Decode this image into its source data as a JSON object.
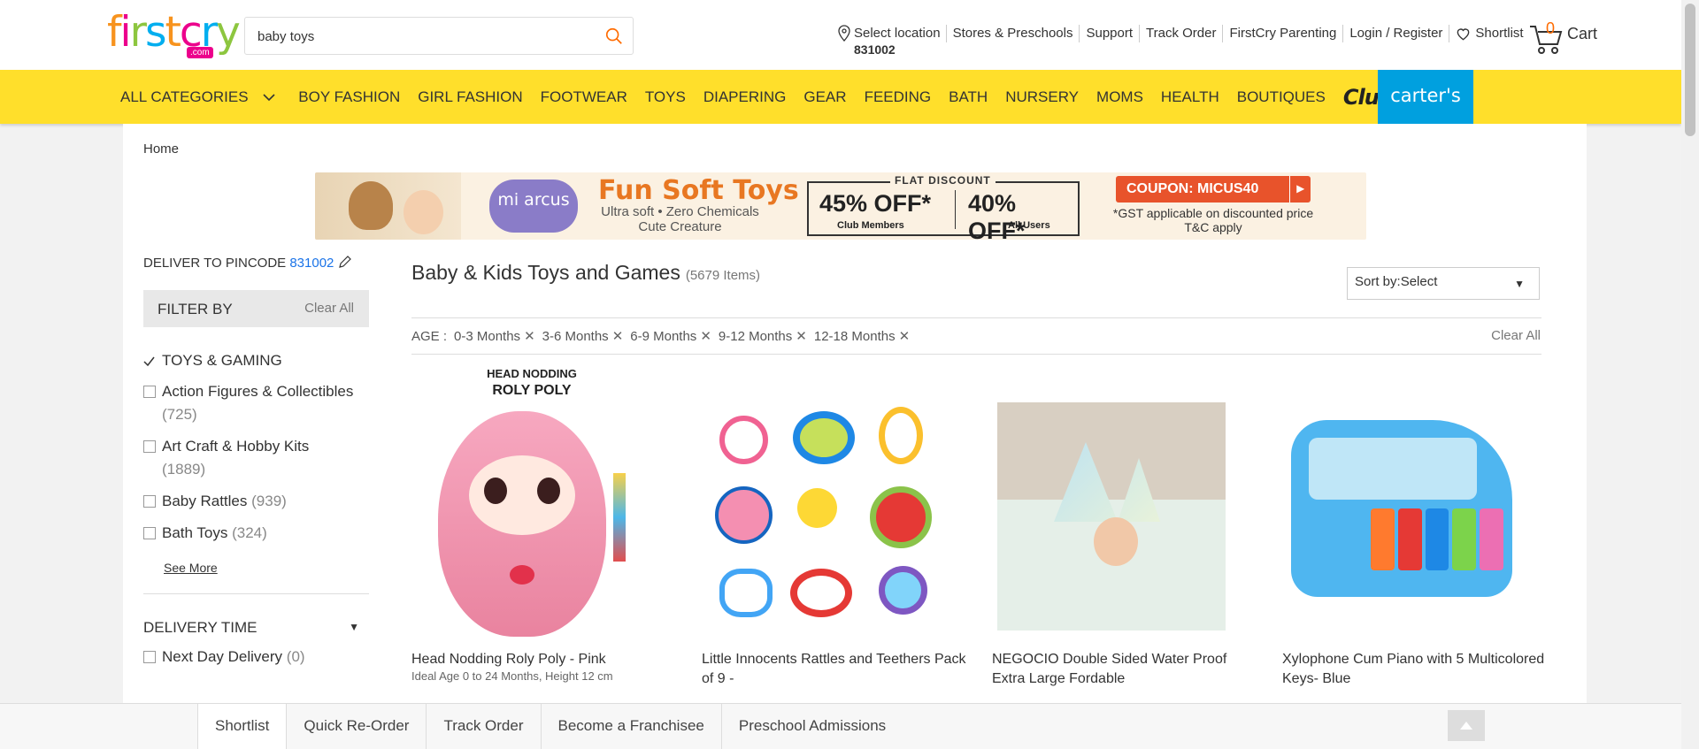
{
  "header": {
    "logo": "firstcry",
    "logo_suffix": ".com",
    "search_value": "baby toys",
    "location_label": "Select location",
    "location_pin": "831002",
    "links": [
      "Stores & Preschools",
      "Support",
      "Track Order",
      "FirstCry Parenting",
      "Login / Register"
    ],
    "shortlist": "Shortlist",
    "cart_count": "0",
    "cart_label": "Cart"
  },
  "nav": {
    "items": [
      "ALL CATEGORIES",
      "BOY FASHION",
      "GIRL FASHION",
      "FOOTWEAR",
      "TOYS",
      "DIAPERING",
      "GEAR",
      "FEEDING",
      "BATH",
      "NURSERY",
      "MOMS",
      "HEALTH",
      "BOUTIQUES"
    ],
    "club": "Club",
    "carters": "carter's"
  },
  "breadcrumb": "Home",
  "banner": {
    "brand": "mi arcus",
    "title": "Fun Soft Toys",
    "subtitle": "Ultra soft • Zero Chemicals Cute Creature",
    "discount_head": "FLAT DISCOUNT",
    "discount1": "45% OFF*",
    "discount1_sub": "Club Members",
    "discount2": "40% OFF*",
    "discount2_sub": "All Users",
    "coupon": "COUPON: MICUS40",
    "gst": "*GST applicable on discounted price T&C apply"
  },
  "sidebar": {
    "deliver_label": "DELIVER TO PINCODE",
    "pincode": "831002",
    "filter_by": "FILTER BY",
    "clear_all": "Clear All",
    "category": "TOYS & GAMING",
    "subcategories": [
      {
        "label": "Action Figures & Collectibles",
        "count": "(725)"
      },
      {
        "label": "Art Craft & Hobby Kits",
        "count": "(1889)"
      },
      {
        "label": "Baby Rattles",
        "count": "(939)"
      },
      {
        "label": "Bath Toys",
        "count": "(324)"
      }
    ],
    "see_more": "See More",
    "delivery_time": "DELIVERY TIME",
    "next_day": {
      "label": "Next Day Delivery",
      "count": "(0)"
    }
  },
  "products": {
    "title": "Baby & Kids Toys and Games",
    "count": "(5679 Items)",
    "sort_label": "Sort by:",
    "sort_value": "Select",
    "filter_label": "AGE :",
    "filters": [
      "0-3 Months",
      "3-6 Months",
      "6-9 Months",
      "9-12 Months",
      "12-18 Months"
    ],
    "clear_all": "Clear All",
    "items": [
      {
        "name": "Head Nodding Roly Poly - Pink",
        "sub": "Ideal Age 0 to 24 Months, Height 12 cm",
        "img_text1": "HEAD NODDING",
        "img_text2": "ROLY POLY"
      },
      {
        "name": "Little Innocents Rattles and Teethers Pack of 9 -",
        "sub": ""
      },
      {
        "name": "NEGOCIO Double Sided Water Proof Extra Large Fordable",
        "sub": ""
      },
      {
        "name": "Xylophone Cum Piano with 5 Multicolored Keys- Blue",
        "sub": ""
      }
    ]
  },
  "footer": {
    "items": [
      "Shortlist",
      "Quick Re-Order",
      "Track Order",
      "Become a Franchisee",
      "Preschool Admissions"
    ]
  }
}
